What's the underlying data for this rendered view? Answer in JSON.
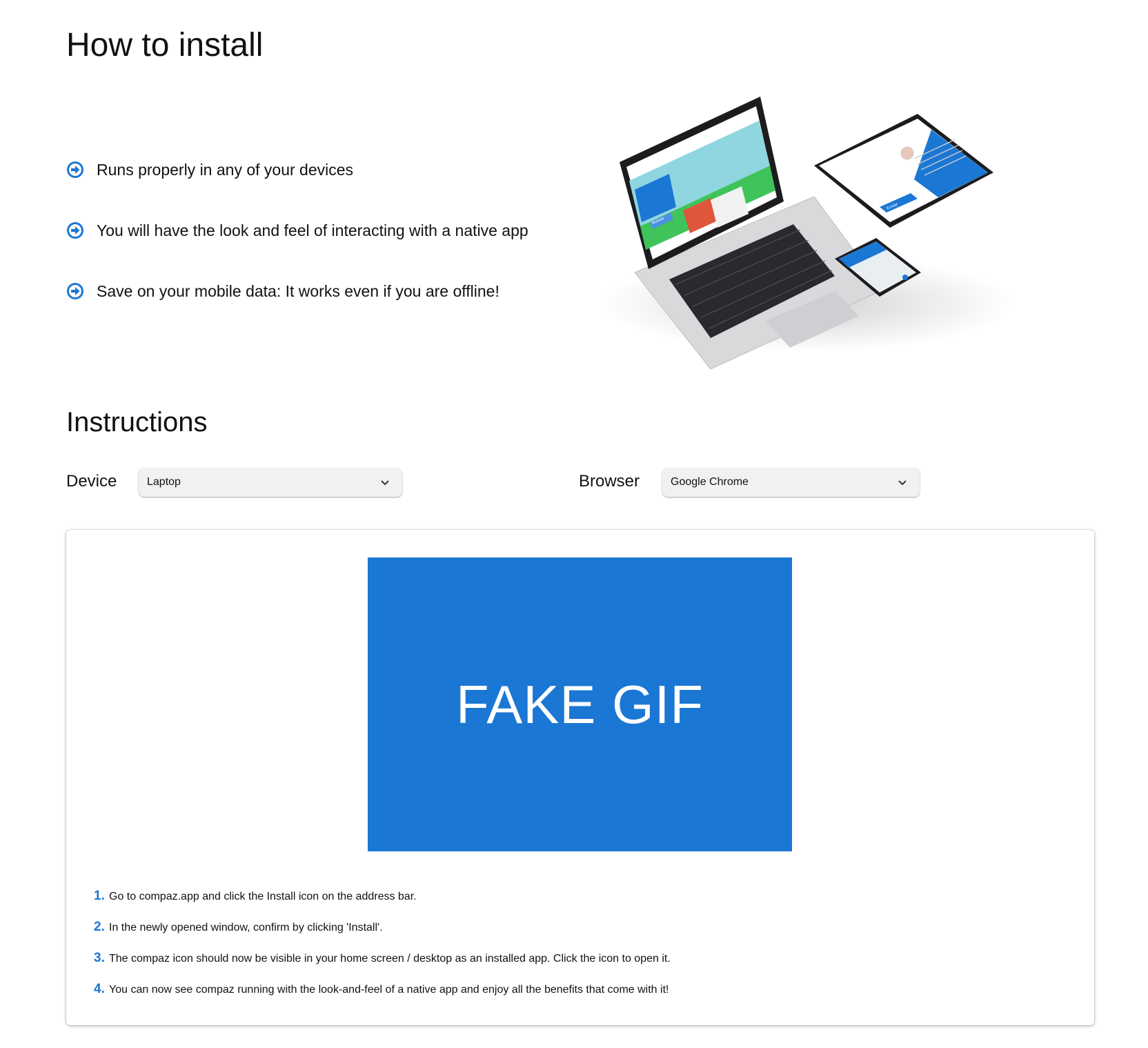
{
  "header": {
    "title": "How to install"
  },
  "features": [
    {
      "icon": "arrow-circle-right-icon",
      "text": "Runs properly in any of your devices"
    },
    {
      "icon": "arrow-circle-right-icon",
      "text": "You will have the look and feel of interacting with a native app"
    },
    {
      "icon": "arrow-circle-right-icon",
      "text": "Save on your mobile data: It works even if you are offline!"
    }
  ],
  "illustration": {
    "icon": "devices-mockup-illustration",
    "laptop_button": "Buscar",
    "tablet_button": "Enviar"
  },
  "instructions": {
    "title": "Instructions",
    "device": {
      "label": "Device",
      "value": "Laptop"
    },
    "browser": {
      "label": "Browser",
      "value": "Google Chrome"
    },
    "gif_text": "FAKE GIF",
    "steps": [
      {
        "num": "1.",
        "text": "Go to compaz.app and click the Install icon on the address bar."
      },
      {
        "num": "2.",
        "text": "In the newly opened window, confirm by clicking 'Install'."
      },
      {
        "num": "3.",
        "text": "The compaz icon should now be visible in your home screen / desktop as an installed app. Click the icon to open it."
      },
      {
        "num": "4.",
        "text": "You can now see compaz running with the look-and-feel of a native app and enjoy all the benefits that come with it!"
      }
    ]
  },
  "colors": {
    "accent": "#1b77d4",
    "select_bg": "#f1f1f1",
    "text": "#111111"
  }
}
